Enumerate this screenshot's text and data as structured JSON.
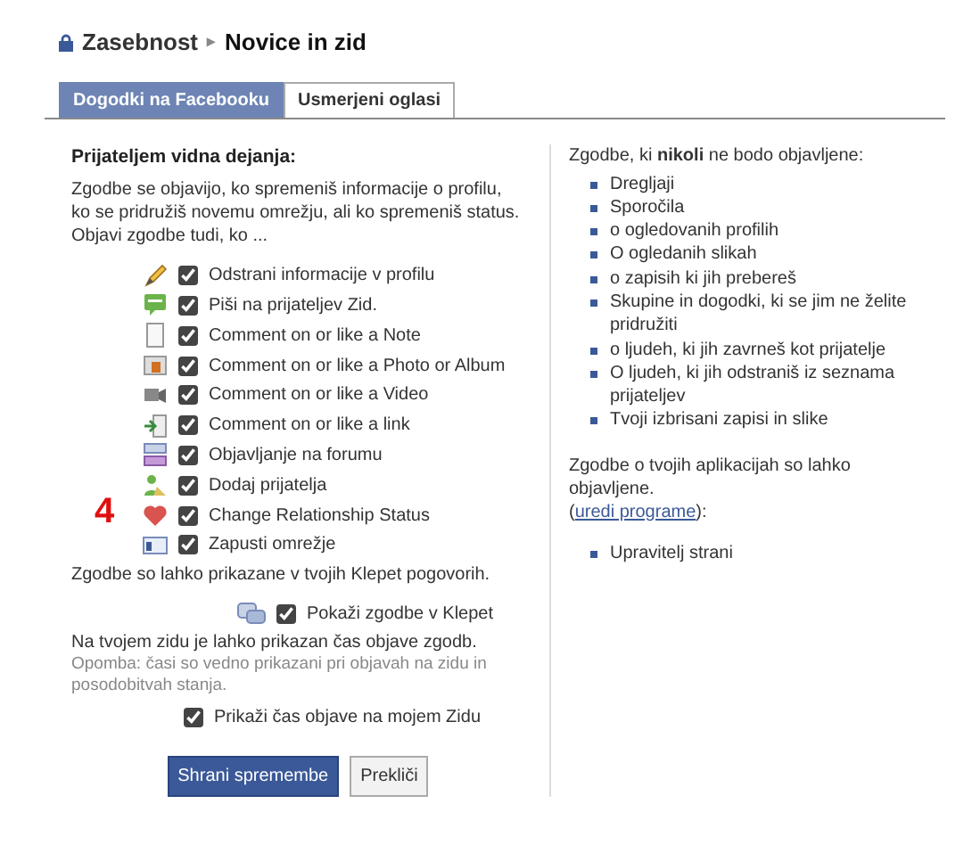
{
  "breadcrumb": {
    "parent": "Zasebnost",
    "separator": "▸",
    "current": "Novice in zid"
  },
  "tabs": [
    {
      "label": "Dogodki na Facebooku",
      "selected": true
    },
    {
      "label": "Usmerjeni oglasi",
      "selected": false
    }
  ],
  "visible_actions": {
    "heading": "Prijateljem vidna dejanja:",
    "intro": "Zgodbe se objavijo, ko spremeniš informacije o profilu, ko se pridružiš novemu omrežju, ali ko spremeniš status. Objavi zgodbe tudi, ko ...",
    "items": [
      {
        "label": "Odstrani informacije v profilu",
        "checked": true
      },
      {
        "label": "Piši na prijateljev Zid.",
        "checked": true
      },
      {
        "label": "Comment on or like a Note",
        "checked": true
      },
      {
        "label": "Comment on or like a Photo or Album",
        "checked": true
      },
      {
        "label": "Comment on or like a Video",
        "checked": true
      },
      {
        "label": "Comment on or like a link",
        "checked": true
      },
      {
        "label": "Objavljanje na forumu",
        "checked": true
      },
      {
        "label": "Dodaj prijatelja",
        "checked": true
      },
      {
        "label": "Change Relationship Status",
        "checked": true,
        "annotation": "4"
      },
      {
        "label": "Zapusti omrežje",
        "checked": true
      }
    ]
  },
  "chat": {
    "note": "Zgodbe so lahko prikazane v tvojih Klepet pogovorih.",
    "option": {
      "label": "Pokaži zgodbe v Klepet",
      "checked": true
    }
  },
  "wall": {
    "note": "Na tvojem zidu je lahko prikazan čas objave zgodb.",
    "hint": "Opomba: časi so vedno prikazani pri objavah na zidu in posodobitvah stanja.",
    "option": {
      "label": "Prikaži čas objave na mojem Zidu",
      "checked": true
    }
  },
  "buttons": [
    {
      "label": "Shrani spremembe",
      "kind": "primary"
    },
    {
      "label": "Prekliči",
      "kind": "secondary"
    }
  ],
  "never_published": {
    "heading": "Zgodbe, ki **nikoli** ne bodo objavljene:",
    "items": [
      "Dregljaji",
      "Sporočila",
      "o ogledovanih profilih",
      "O ogledanih slikah",
      "o zapisih ki jih prebereš",
      "Skupine in dogodki, ki se jim ne želite pridružiti",
      "o ljudeh, ki jih zavrneš kot prijatelje",
      "O ljudeh, ki jih odstraniš iz seznama prijateljev",
      "Tvoji izbrisani zapisi in slike"
    ]
  },
  "apps": {
    "note": "Zgodbe o tvojih aplikacijah so lahko objavljene.",
    "link_open": "(",
    "link": "uredi programe",
    "link_close": "):",
    "items": [
      "Upravitelj strani"
    ]
  }
}
